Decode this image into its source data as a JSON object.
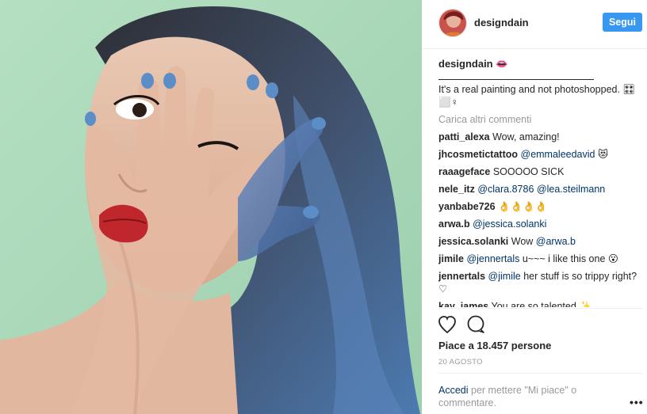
{
  "header": {
    "username": "designdain",
    "follow_label": "Segui"
  },
  "caption": {
    "username": "designdain",
    "username_emoji": "👄",
    "text": "It's a real painting and not photoshopped. 🎛 ⬜♀"
  },
  "load_more_label": "Carica altri commenti",
  "comments": [
    {
      "user": "patti_alexa",
      "parts": [
        {
          "t": "Wow, amazing!"
        }
      ]
    },
    {
      "user": "jhcosmetictattoo",
      "parts": [
        {
          "m": "@emmaleedavid"
        },
        {
          "t": " 😻"
        }
      ]
    },
    {
      "user": "raaageface",
      "parts": [
        {
          "t": "SOOOOO SICK"
        }
      ]
    },
    {
      "user": "nele_itz",
      "parts": [
        {
          "m": "@clara.8786"
        },
        {
          "t": " "
        },
        {
          "m": "@lea.steilmann"
        }
      ]
    },
    {
      "user": "yanbabe726",
      "parts": [
        {
          "t": "👌👌👌👌"
        }
      ]
    },
    {
      "user": "arwa.b",
      "parts": [
        {
          "m": "@jessica.solanki"
        }
      ]
    },
    {
      "user": "jessica.solanki",
      "parts": [
        {
          "t": "Wow "
        },
        {
          "m": "@arwa.b"
        }
      ]
    },
    {
      "user": "jimile",
      "parts": [
        {
          "m": "@jennertals"
        },
        {
          "t": " u~~~ i like this one 😮"
        }
      ]
    },
    {
      "user": "jennertals",
      "parts": [
        {
          "m": "@jimile"
        },
        {
          "t": " her stuff is so trippy right? ♡"
        }
      ]
    },
    {
      "user": "kay_james",
      "parts": [
        {
          "t": "You are so talented ✨"
        }
      ]
    }
  ],
  "actions": {
    "like_icon": "heart-icon",
    "comment_icon": "comment-bubble-icon"
  },
  "likes_text": "Piace a 18.457 persone",
  "date_text": "20 AGOSTO",
  "login_prompt": {
    "link": "Accedi",
    "text": " per mettere \"Mi piace\" o commentare."
  },
  "more_icon": "•••",
  "colors": {
    "follow_button": "#3897f0",
    "mention_link": "#003569",
    "muted_text": "#999999",
    "background_mint": "#a9dab8",
    "nail_blue": "#5b8dc7",
    "hair_blue": "#3d5a80"
  }
}
